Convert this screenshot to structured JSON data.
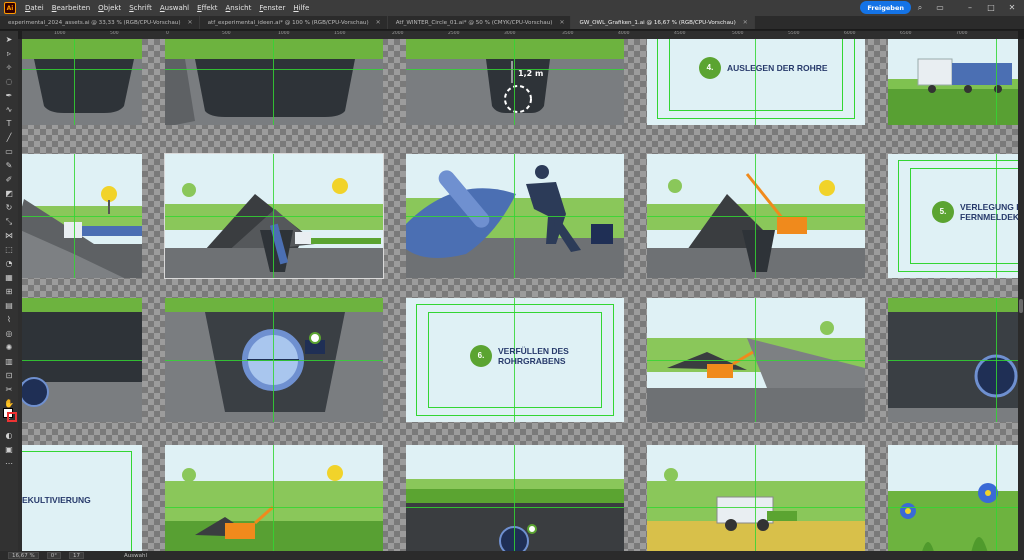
{
  "app": {
    "logo": "Ai"
  },
  "menu": [
    "Datei",
    "Bearbeiten",
    "Objekt",
    "Schrift",
    "Auswahl",
    "Effekt",
    "Ansicht",
    "Fenster",
    "Hilfe"
  ],
  "share_label": "Freigeben",
  "tabs": [
    {
      "label": "experimental_2024_assets.ai @ 33,33 % (RGB/CPU-Vorschau)",
      "active": false
    },
    {
      "label": "atf_experimental_ideen.ai* @ 100 % (RGB/CPU-Vorschau)",
      "active": false
    },
    {
      "label": "Atf_WINTER_Circle_01.ai* @ 50 % (CMYK/CPU-Vorschau)",
      "active": false
    },
    {
      "label": "GW_OWL_Grafiken_1.ai @ 16,67 % (RGB/CPU-Vorschau)",
      "active": true
    }
  ],
  "ruler_ticks": [
    "1000",
    "500",
    "0",
    "500",
    "1000",
    "1500",
    "2000",
    "2500",
    "3000",
    "3500",
    "4000",
    "4500",
    "5000",
    "5500",
    "6000",
    "6500",
    "7000"
  ],
  "steps": {
    "s4": {
      "num": "4.",
      "text": "AUSLEGEN DER ROHRE"
    },
    "s5": {
      "num": "5.",
      "line1": "VERLEGUNG D",
      "line2": "FERNMELDEKA"
    },
    "s6": {
      "num": "6.",
      "line1": "VERFÜLLEN DES",
      "line2": "ROHRGRABENS"
    },
    "s7": {
      "text": "EKULTIVIERUNG"
    }
  },
  "measure_label": "1,2 m",
  "status": {
    "zoom": "16,67 %",
    "angle": "0°",
    "artboard": "17",
    "mode": "Auswahl"
  },
  "colors": {
    "accent": "#1473e6",
    "guide": "#33d633",
    "brand_green": "#5ba431",
    "brand_navy": "#273a6b"
  }
}
